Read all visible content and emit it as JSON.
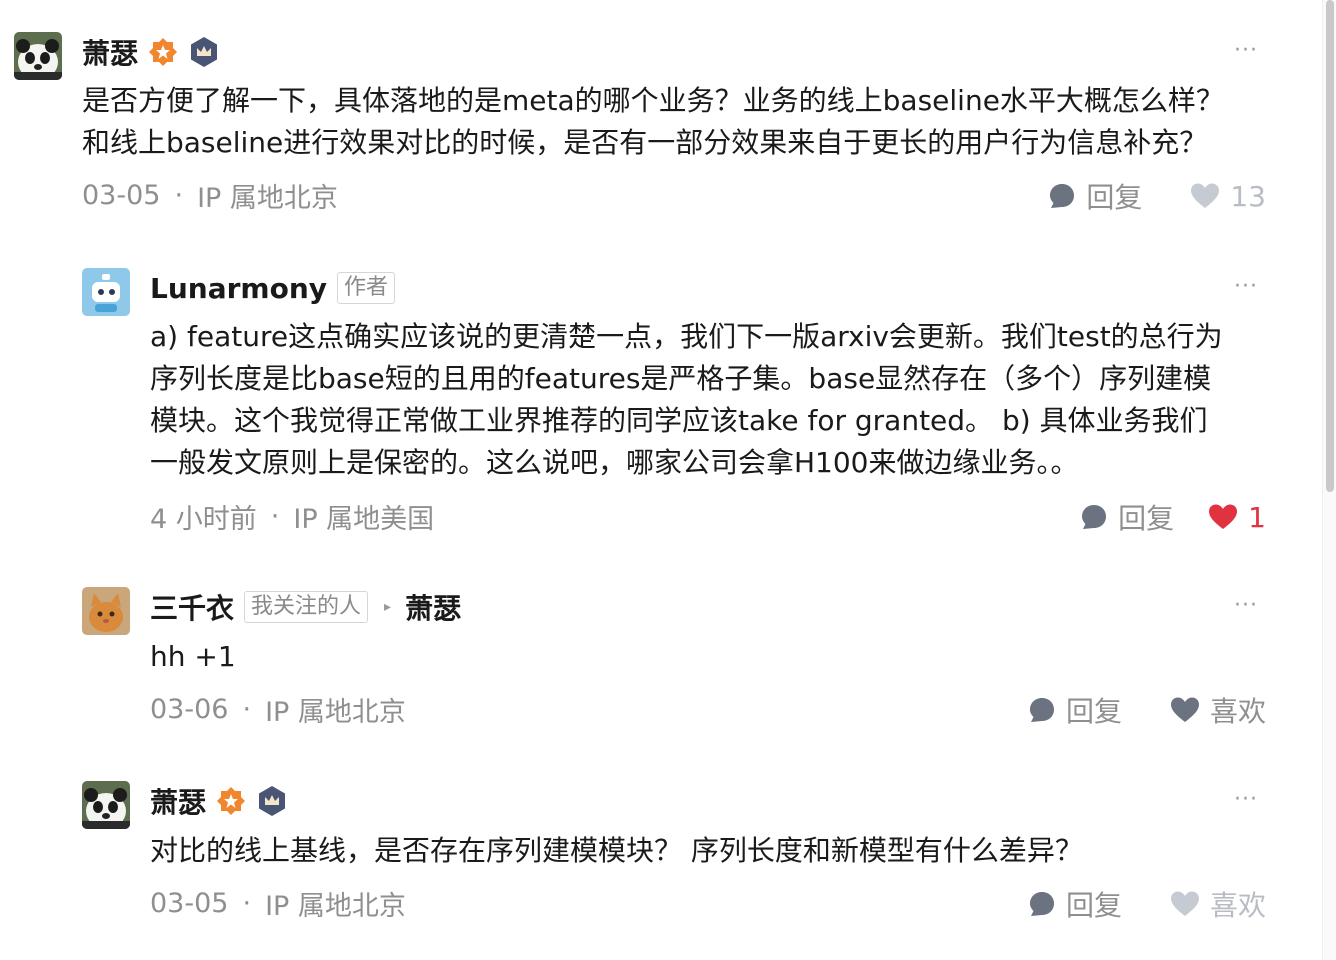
{
  "comments": [
    {
      "author": "萧瑟",
      "content": "是否方便了解一下，具体落地的是meta的哪个业务？业务的线上baseline水平大概怎么样？\n和线上baseline进行效果对比的时候，是否有一部分效果来自于更长的用户行为信息补充？",
      "date": "03-05",
      "dot": "·",
      "location": "IP 属地北京",
      "reply_label": "回复",
      "like_label": "13",
      "more": "···"
    },
    {
      "author": "Lunarmony",
      "tag": "作者",
      "content": "a) feature这点确实应该说的更清楚一点，我们下一版arxiv会更新。我们test的总行为\n序列长度是比base短的且用的features是严格子集。base显然存在（多个）序列建模\n模块。这个我觉得正常做工业界推荐的同学应该take for granted。 b) 具体业务我们\n一般发文原则上是保密的。这么说吧，哪家公司会拿H100来做边缘业务。。",
      "date": "4 小时前",
      "dot": "·",
      "location": "IP 属地美国",
      "reply_label": "回复",
      "like_label": "1",
      "more": "···"
    },
    {
      "author": "三千衣",
      "tag": "我关注的人",
      "reply_arrow": "▸",
      "reply_to": "萧瑟",
      "content": "hh +1",
      "date": "03-06",
      "dot": "·",
      "location": "IP 属地北京",
      "reply_label": "回复",
      "like_label": "喜欢",
      "more": "···"
    },
    {
      "author": "萧瑟",
      "content": "对比的线上基线，是否存在序列建模模块？ 序列长度和新模型有什么差异？",
      "date": "03-05",
      "dot": "·",
      "location": "IP 属地北京",
      "reply_label": "回复",
      "like_label": "喜欢",
      "more": "···"
    }
  ],
  "colors": {
    "text": "#1a1a1a",
    "meta": "#8f8f8f",
    "like_active": "#e0323f",
    "badge_orange": "#f0862e",
    "badge_crown": "#4a5575"
  },
  "icons": [
    "panda-avatar",
    "robot-avatar",
    "cat-avatar",
    "orange-badge-icon",
    "crown-badge-icon",
    "more-icon",
    "reply-bubble-icon",
    "heart-icon"
  ]
}
